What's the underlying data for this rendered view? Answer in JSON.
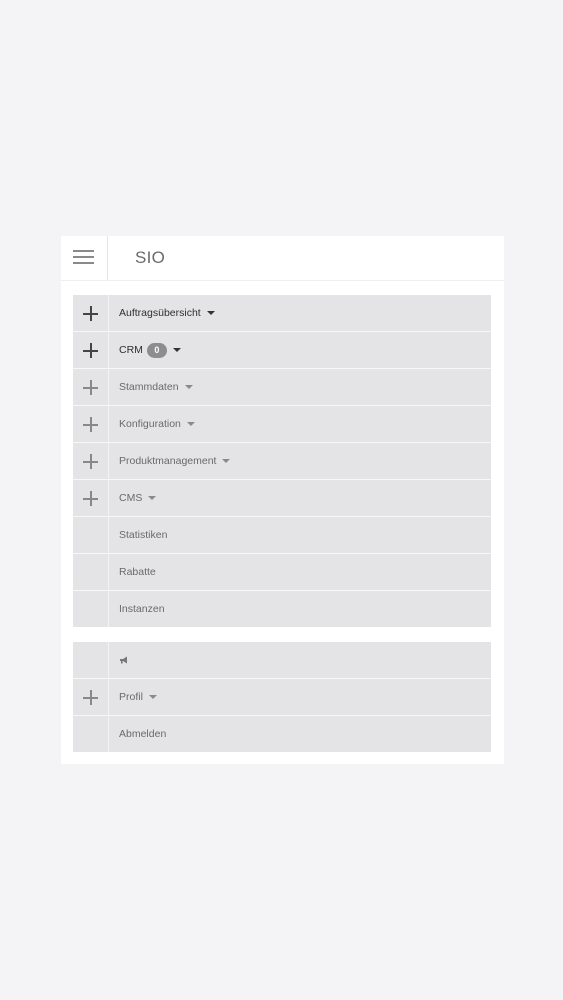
{
  "app": {
    "brand": "SIO"
  },
  "menu_main": {
    "items": [
      {
        "label": "Auftragsübersicht",
        "has_plus": true,
        "has_caret": true
      },
      {
        "label": "CRM",
        "badge": "0",
        "has_plus": true,
        "has_caret": true
      },
      {
        "label": "Stammdaten",
        "has_plus": true,
        "has_caret": true
      },
      {
        "label": "Konfiguration",
        "has_plus": true,
        "has_caret": true
      },
      {
        "label": "Produktmanagement",
        "has_plus": true,
        "has_caret": true
      },
      {
        "label": "CMS",
        "has_plus": true,
        "has_caret": true
      },
      {
        "label": "Statistiken",
        "has_plus": false,
        "has_caret": false
      },
      {
        "label": "Rabatte",
        "has_plus": false,
        "has_caret": false
      },
      {
        "label": "Instanzen",
        "has_plus": false,
        "has_caret": false
      }
    ]
  },
  "menu_secondary": {
    "items": [
      {
        "icon": "megaphone-icon",
        "has_plus": false
      },
      {
        "label": "Profil",
        "has_plus": true,
        "has_caret": true
      },
      {
        "label": "Abmelden",
        "has_plus": false,
        "has_caret": false
      }
    ]
  }
}
